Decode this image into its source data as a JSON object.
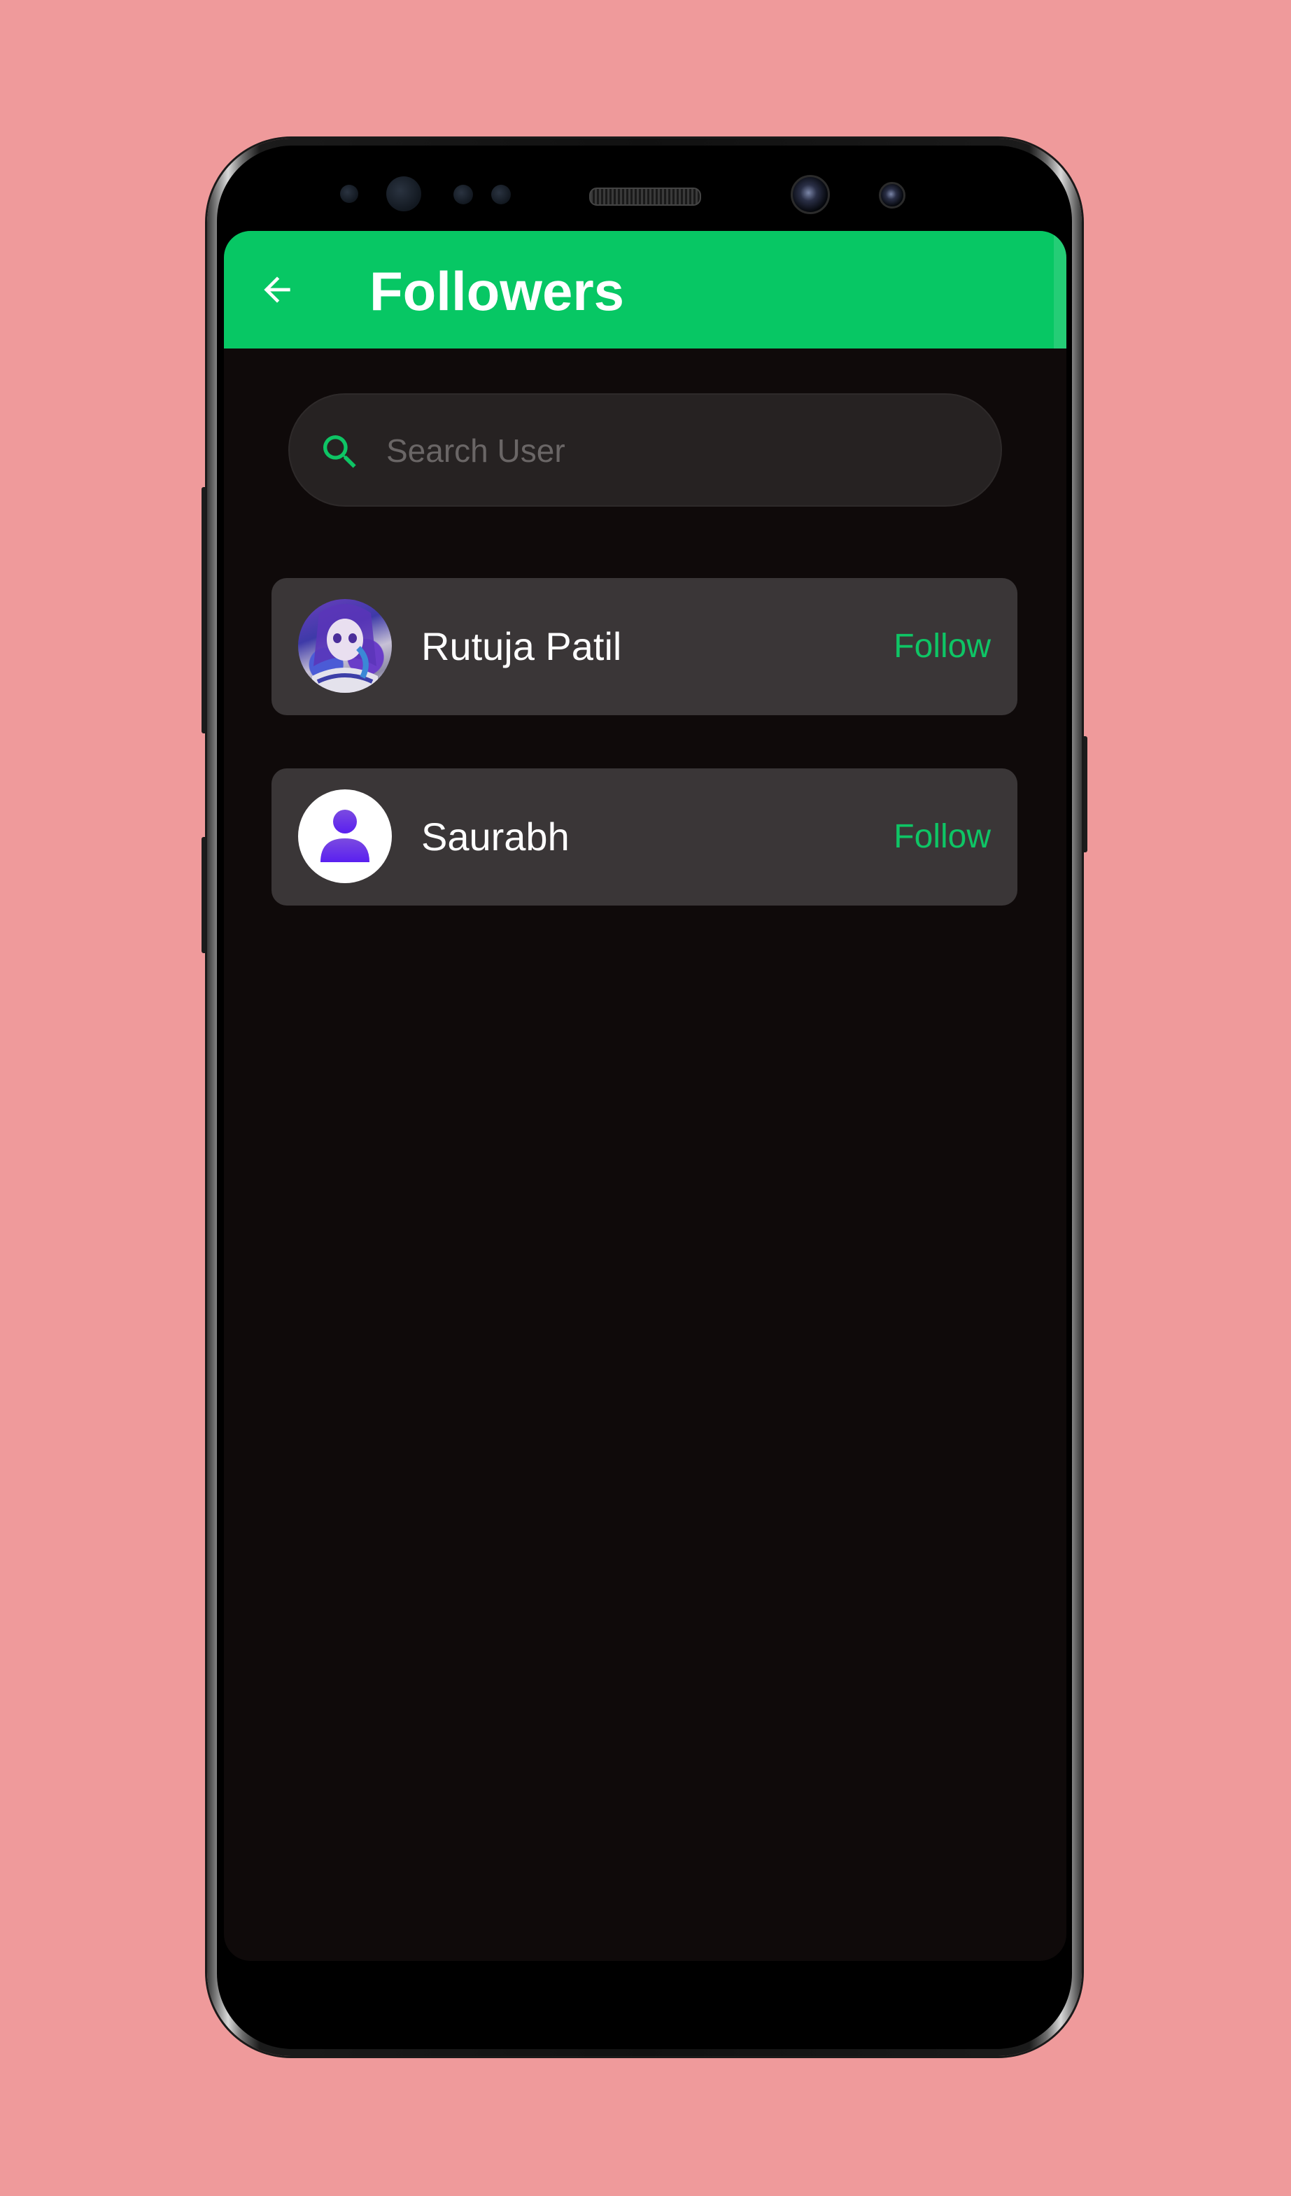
{
  "theme": {
    "background": "#ef9a9b",
    "app_bar": "#07c764",
    "screen": "#0f0a0a",
    "card": "#3a3637",
    "accent": "#0ec565"
  },
  "app_bar": {
    "back_icon": "arrow-left-icon",
    "title": "Followers"
  },
  "search": {
    "icon": "search-icon",
    "placeholder": "Search User",
    "value": ""
  },
  "followers": [
    {
      "name": "Rutuja Patil",
      "action": "Follow",
      "avatar": "anime-character-avatar"
    },
    {
      "name": "Saurabh",
      "action": "Follow",
      "avatar": "default-user-avatar"
    }
  ]
}
